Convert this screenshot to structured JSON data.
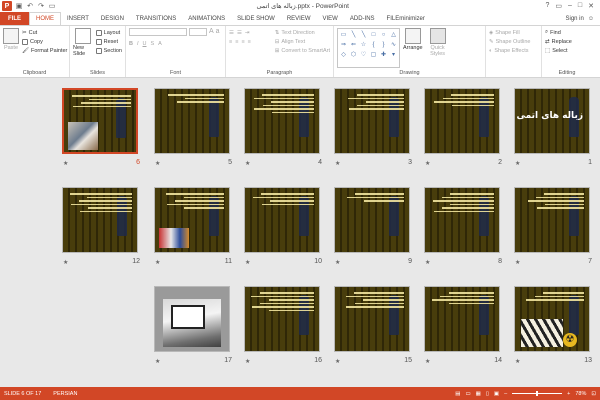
{
  "window": {
    "title": "زباله های اتمی.pptx - PowerPoint",
    "sign_in": "Sign in"
  },
  "tabs": [
    "FILE",
    "HOME",
    "INSERT",
    "DESIGN",
    "TRANSITIONS",
    "ANIMATIONS",
    "SLIDE SHOW",
    "REVIEW",
    "VIEW",
    "ADD-INS",
    "FILEminimizer"
  ],
  "ribbon": {
    "clipboard": {
      "label": "Clipboard",
      "paste": "Paste",
      "cut": "Cut",
      "copy": "Copy",
      "format_painter": "Format Painter"
    },
    "slides": {
      "label": "Slides",
      "new_slide": "New Slide",
      "layout": "Layout",
      "reset": "Reset",
      "section": "Section"
    },
    "font": {
      "label": "Font"
    },
    "paragraph": {
      "label": "Paragraph",
      "text_direction": "Text Direction",
      "align_text": "Align Text",
      "convert_smartart": "Convert to SmartArt"
    },
    "drawing": {
      "label": "Drawing",
      "arrange": "Arrange",
      "quick_styles": "Quick Styles",
      "shape_fill": "Shape Fill",
      "shape_outline": "Shape Outline",
      "shape_effects": "Shape Effects"
    },
    "editing": {
      "label": "Editing",
      "find": "Find",
      "replace": "Replace",
      "select": "Select"
    }
  },
  "slides": [
    {
      "num": "1",
      "title": "زباله های اتمی"
    },
    {
      "num": "2"
    },
    {
      "num": "3"
    },
    {
      "num": "4"
    },
    {
      "num": "5"
    },
    {
      "num": "6",
      "selected": true
    },
    {
      "num": "7"
    },
    {
      "num": "8"
    },
    {
      "num": "9"
    },
    {
      "num": "10"
    },
    {
      "num": "11"
    },
    {
      "num": "12"
    },
    {
      "num": "13"
    },
    {
      "num": "14"
    },
    {
      "num": "15"
    },
    {
      "num": "16"
    },
    {
      "num": "17"
    }
  ],
  "status": {
    "slide_info": "SLIDE 6 OF 17",
    "language": "PERSIAN",
    "zoom": "78%"
  },
  "colors": {
    "accent": "#d24726"
  }
}
